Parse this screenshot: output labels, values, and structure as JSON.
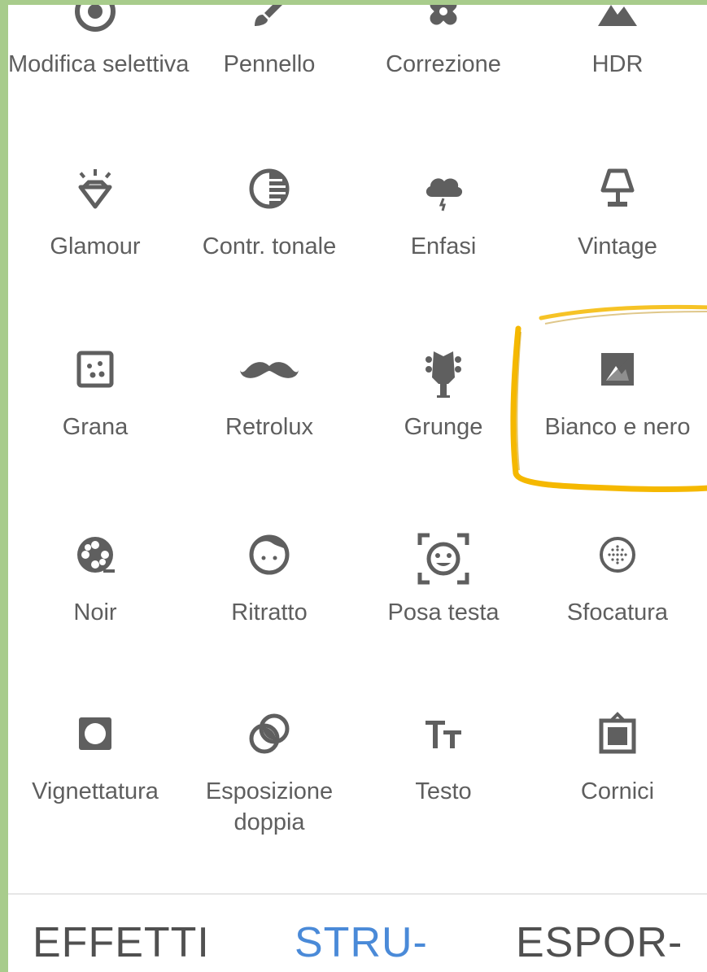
{
  "tools": [
    {
      "label": "Modifica selettiva",
      "icon": "selective-target-icon"
    },
    {
      "label": "Pennello",
      "icon": "brush-icon"
    },
    {
      "label": "Correzione",
      "icon": "bandage-icon"
    },
    {
      "label": "HDR",
      "icon": "mountain-icon"
    },
    {
      "label": "Glamour",
      "icon": "diamond-icon"
    },
    {
      "label": "Contr. tonale",
      "icon": "tonal-contrast-icon"
    },
    {
      "label": "Enfasi",
      "icon": "storm-cloud-icon"
    },
    {
      "label": "Vintage",
      "icon": "lamp-icon"
    },
    {
      "label": "Grana",
      "icon": "grain-icon"
    },
    {
      "label": "Retrolux",
      "icon": "mustache-icon"
    },
    {
      "label": "Grunge",
      "icon": "guitar-head-icon"
    },
    {
      "label": "Bianco e nero",
      "icon": "black-white-icon"
    },
    {
      "label": "Noir",
      "icon": "film-reel-icon"
    },
    {
      "label": "Ritratto",
      "icon": "face-icon"
    },
    {
      "label": "Posa testa",
      "icon": "face-frame-icon"
    },
    {
      "label": "Sfocatura",
      "icon": "blur-dots-icon"
    },
    {
      "label": "Vignettatura",
      "icon": "vignette-icon"
    },
    {
      "label": "Esposizione doppia",
      "icon": "double-exposure-icon"
    },
    {
      "label": "Testo",
      "icon": "text-icon"
    },
    {
      "label": "Cornici",
      "icon": "frame-icon"
    }
  ],
  "tabs": [
    {
      "label": "EFFETTI",
      "active": false
    },
    {
      "label": "STRU-",
      "active": true
    },
    {
      "label": "ESPOR-",
      "active": false
    }
  ],
  "colors": {
    "icon": "#5f5f5f",
    "text": "#5e5e5e",
    "accent": "#4a8ad8",
    "highlight": "#f5b800",
    "frame": "#a8cc8c"
  }
}
